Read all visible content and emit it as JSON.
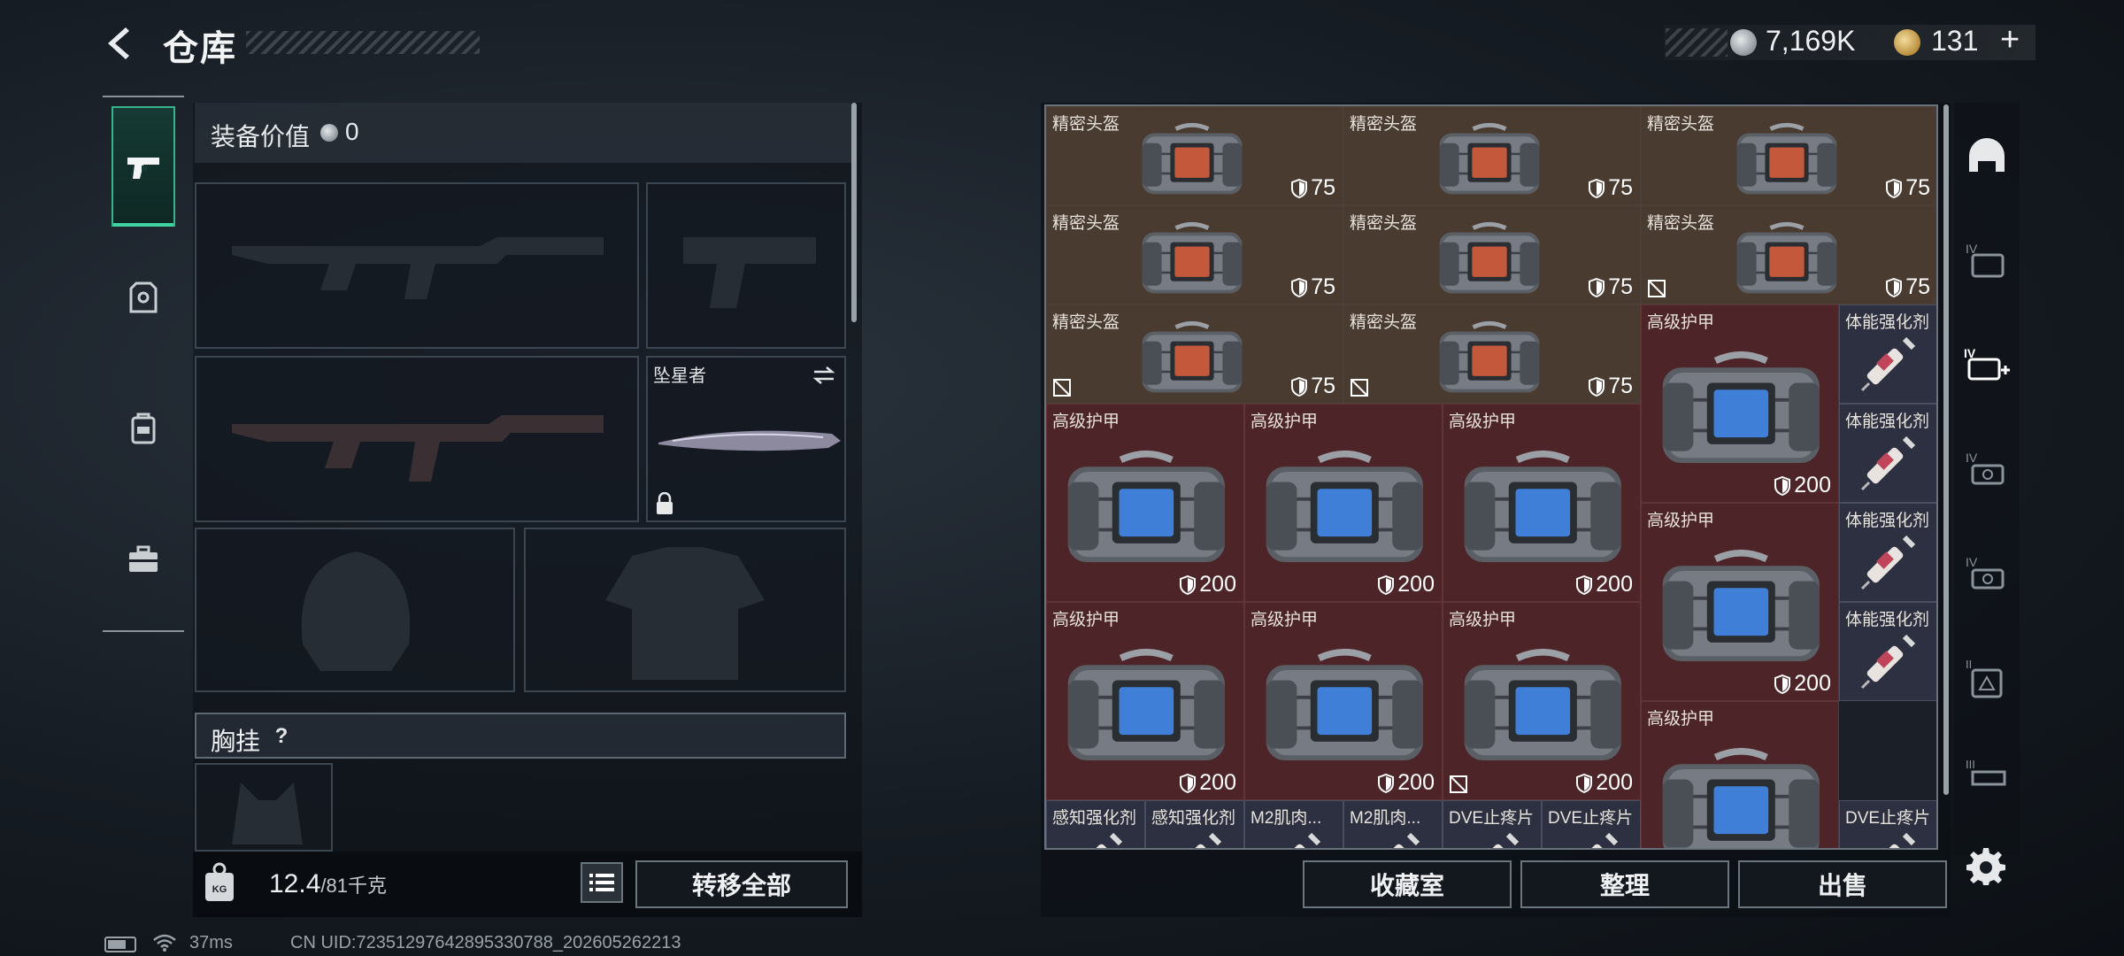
{
  "header": {
    "title": "仓库",
    "silver_amount": "7,169K",
    "gold_amount": "131"
  },
  "loadout": {
    "equip_value_label": "装备价值",
    "equip_value": "0",
    "melee_name": "坠星者",
    "chest_rig_label": "胸挂",
    "help_label": "?",
    "weight_current": "12.4",
    "weight_max": "/81千克",
    "transfer_all": "转移全部"
  },
  "status": {
    "ping": "37ms",
    "uid": "CN UID:72351297642895330788_202605262213"
  },
  "stash": {
    "items": [
      {
        "name": "精密头盔",
        "value": "75",
        "type": "helmet",
        "broken": false
      },
      {
        "name": "精密头盔",
        "value": "75",
        "type": "helmet",
        "broken": false
      },
      {
        "name": "精密头盔",
        "value": "75",
        "type": "helmet",
        "broken": false
      },
      {
        "name": "精密头盔",
        "value": "75",
        "type": "helmet",
        "broken": false
      },
      {
        "name": "精密头盔",
        "value": "75",
        "type": "helmet",
        "broken": false
      },
      {
        "name": "精密头盔",
        "value": "75",
        "type": "helmet",
        "broken": true
      },
      {
        "name": "精密头盔",
        "value": "75",
        "type": "helmet",
        "broken": true
      },
      {
        "name": "精密头盔",
        "value": "75",
        "type": "helmet",
        "broken": true
      },
      {
        "name": "高级护甲",
        "value": "200",
        "type": "armor",
        "broken": false
      },
      {
        "name": "高级护甲",
        "value": "200",
        "type": "armor",
        "broken": false
      },
      {
        "name": "高级护甲",
        "value": "200",
        "type": "armor",
        "broken": false
      },
      {
        "name": "高级护甲",
        "value": "200",
        "type": "armor",
        "broken": false
      },
      {
        "name": "高级护甲",
        "value": "200",
        "type": "armor",
        "broken": false
      },
      {
        "name": "高级护甲",
        "value": "200",
        "type": "armor",
        "broken": false
      },
      {
        "name": "高级护甲",
        "value": "200",
        "type": "armor",
        "broken": true
      },
      {
        "name": "高级护甲",
        "value": "200",
        "type": "armor",
        "broken": false
      },
      {
        "name": "高级护甲",
        "value": "",
        "type": "armor",
        "broken": false
      }
    ],
    "consumables": [
      {
        "name": "体能强化剂"
      },
      {
        "name": "体能强化剂"
      },
      {
        "name": "体能强化剂"
      },
      {
        "name": "体能强化剂"
      },
      {
        "name": "感知强化剂"
      },
      {
        "name": "感知强化剂"
      },
      {
        "name": "M2肌肉..."
      },
      {
        "name": "M2肌肉..."
      },
      {
        "name": "DVE止疼片"
      },
      {
        "name": "DVE止疼片"
      },
      {
        "name": "DVE止疼片"
      }
    ],
    "buttons": {
      "collection": "收藏室",
      "organize": "整理",
      "sell": "出售"
    }
  },
  "filters": [
    "helmet-filter",
    "backpack-tier-iv",
    "medkit-tier-iv",
    "ammo-tier-iv",
    "ammo-tier-iv-b",
    "armor-tier-ii",
    "weapon-tier-iii"
  ],
  "colors": {
    "accent": "#3fd39f",
    "helmet_bg": "#4a3b30",
    "armor_bg": "#4d2428",
    "consumable_bg": "#2d3040"
  }
}
